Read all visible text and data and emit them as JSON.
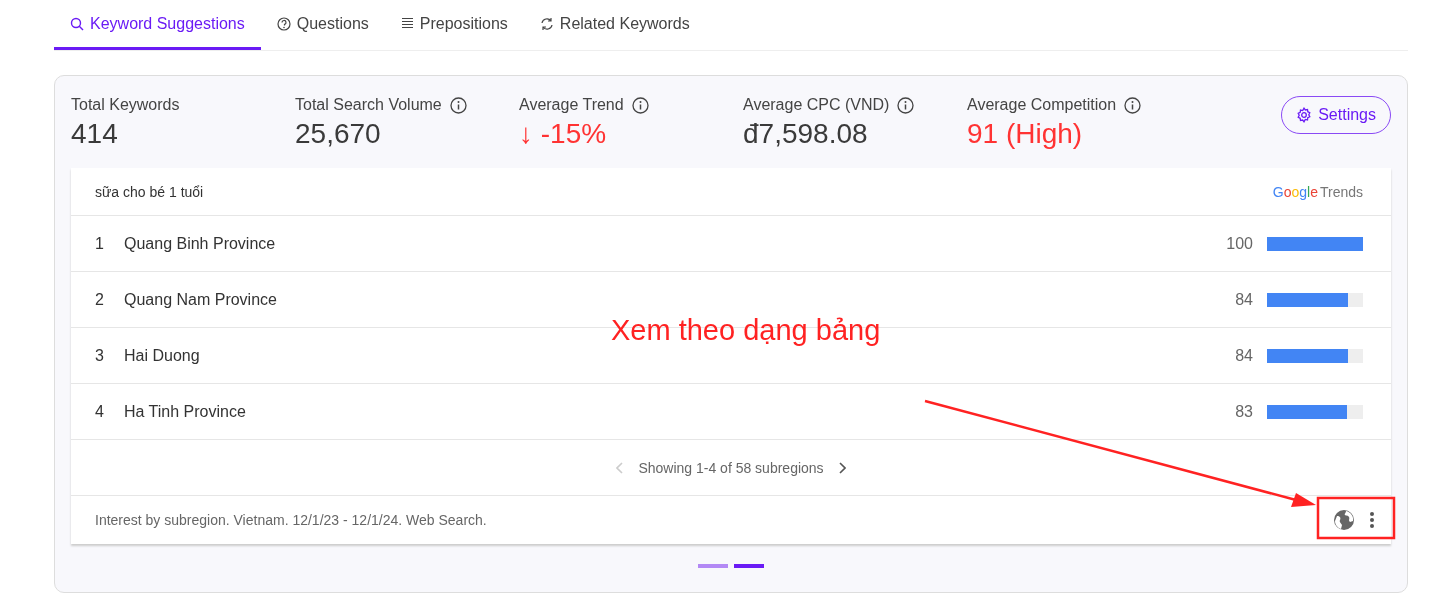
{
  "tabs": [
    {
      "label": "Keyword Suggestions",
      "selected": true
    },
    {
      "label": "Questions",
      "selected": false
    },
    {
      "label": "Prepositions",
      "selected": false
    },
    {
      "label": "Related Keywords",
      "selected": false
    }
  ],
  "stats": [
    {
      "label": "Total Keywords",
      "value": "414",
      "info": false,
      "kind": "plain"
    },
    {
      "label": "Total Search Volume",
      "value": "25,670",
      "info": true,
      "kind": "plain"
    },
    {
      "label": "Average Trend",
      "value": "↓ -15%",
      "info": true,
      "kind": "alert"
    },
    {
      "label": "Average CPC (VND)",
      "value": "đ7,598.08",
      "info": true,
      "kind": "plain"
    },
    {
      "label": "Average Competition",
      "value": "91 (High)",
      "info": true,
      "kind": "alert"
    }
  ],
  "settings_button": "Settings",
  "trends_panel": {
    "query": "sữa cho bé 1 tuổi",
    "logo": {
      "brand": "Google",
      "product": "Trends"
    },
    "rows": [
      {
        "rank": "1",
        "region": "Quang Binh Province",
        "value": "100",
        "level": 1.0
      },
      {
        "rank": "2",
        "region": "Quang Nam Province",
        "value": "84",
        "level": 0.84
      },
      {
        "rank": "3",
        "region": "Hai Duong",
        "value": "84",
        "level": 0.84
      },
      {
        "rank": "4",
        "region": "Ha Tinh Province",
        "value": "83",
        "level": 0.83
      }
    ],
    "pagination": "Showing 1-4 of 58 subregions",
    "footer": "Interest by subregion. Vietnam. 12/1/23 - 12/1/24. Web Search."
  },
  "carousel_dots": [
    {
      "selected": false
    },
    {
      "selected": true
    }
  ],
  "annotation": {
    "text": "Xem theo dạng bảng"
  }
}
